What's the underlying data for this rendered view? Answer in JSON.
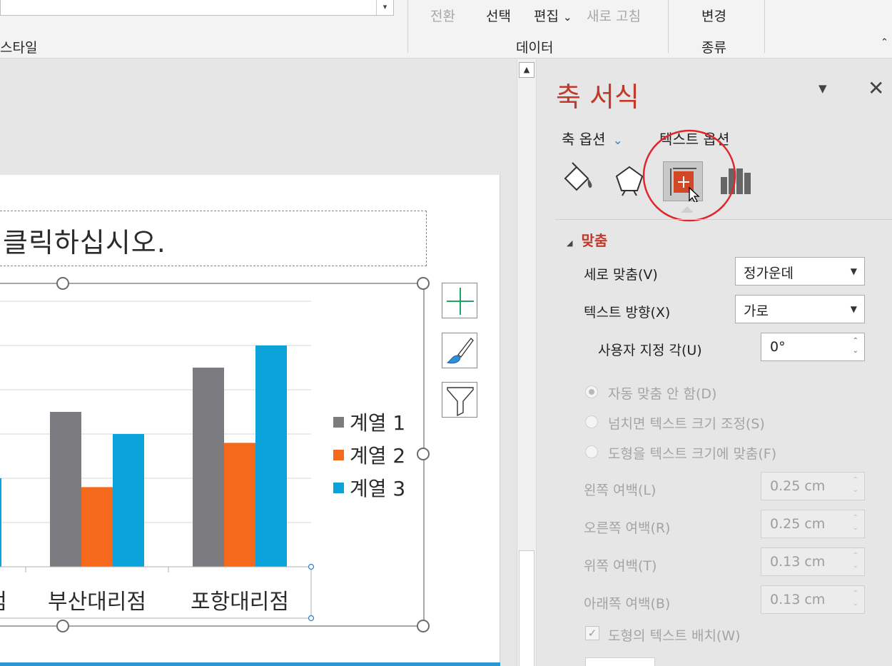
{
  "ribbon": {
    "style_group_label": "스타일",
    "transition_label": "전환",
    "select_label": "선택",
    "edit_label": "편집",
    "edit_chevron": "⌄",
    "refresh_label": "새로 고침",
    "data_group_label": "데이터",
    "change_label": "변경",
    "type_group_label": "종류"
  },
  "slide": {
    "title_placeholder": "클릭하십시오."
  },
  "chart_data": {
    "type": "bar",
    "categories": [
      "",
      "부산대리점",
      "포항대리점"
    ],
    "category_labels_visible": [
      "점",
      "부산대리점",
      "포항대리점"
    ],
    "series": [
      {
        "name": "계열 1",
        "color": "#7b7b80",
        "values": [
          null,
          3.5,
          4.5
        ]
      },
      {
        "name": "계열 2",
        "color": "#f4691c",
        "values": [
          null,
          1.8,
          2.8
        ]
      },
      {
        "name": "계열 3",
        "color": "#0aa2d9",
        "values": [
          2.0,
          3.0,
          5.0
        ]
      }
    ],
    "ylim": [
      0,
      6
    ],
    "grid": true,
    "legend_position": "right"
  },
  "chart_side_buttons": [
    "chart-elements-plus-icon",
    "chart-styles-brush-icon",
    "chart-filter-icon"
  ],
  "panel": {
    "title": "축 서식",
    "menu_arrow": "▼",
    "close_glyph": "✕",
    "tab_axis_options": "축 옵션",
    "tab_axis_chevron": "⌄",
    "tab_text_options": "텍스트 옵션",
    "section_title": "맞춤",
    "section_triangle": "◢",
    "vertical_align_label": "세로 맞춤(V)",
    "vertical_align_value": "정가운데",
    "text_direction_label": "텍스트 방향(X)",
    "text_direction_value": "가로",
    "custom_angle_label": "사용자 지정 각(U)",
    "custom_angle_value": "0°",
    "radio_no_autofit": "자동 맞춤 안 함(D)",
    "radio_shrink_text": "넘치면 텍스트 크기 조정(S)",
    "radio_resize_shape": "도형을 텍스트 크기에 맞춤(F)",
    "left_margin_label": "왼쪽 여백(L)",
    "left_margin_value": "0.25 cm",
    "right_margin_label": "오른쪽 여백(R)",
    "right_margin_value": "0.25 cm",
    "top_margin_label": "위쪽 여백(T)",
    "top_margin_value": "0.13 cm",
    "bottom_margin_label": "아래쪽 여백(B)",
    "bottom_margin_value": "0.13 cm",
    "wrap_text_label": "도형의 텍스트 배치(W)",
    "wrap_checked": "✓",
    "spin_up": "⌃",
    "spin_down": "⌄",
    "dropdown_arrow": "▼"
  },
  "colors": {
    "accent_red": "#c0392b",
    "highlight_circle": "#e0262c",
    "selected_icon_fill": "#d24726"
  }
}
